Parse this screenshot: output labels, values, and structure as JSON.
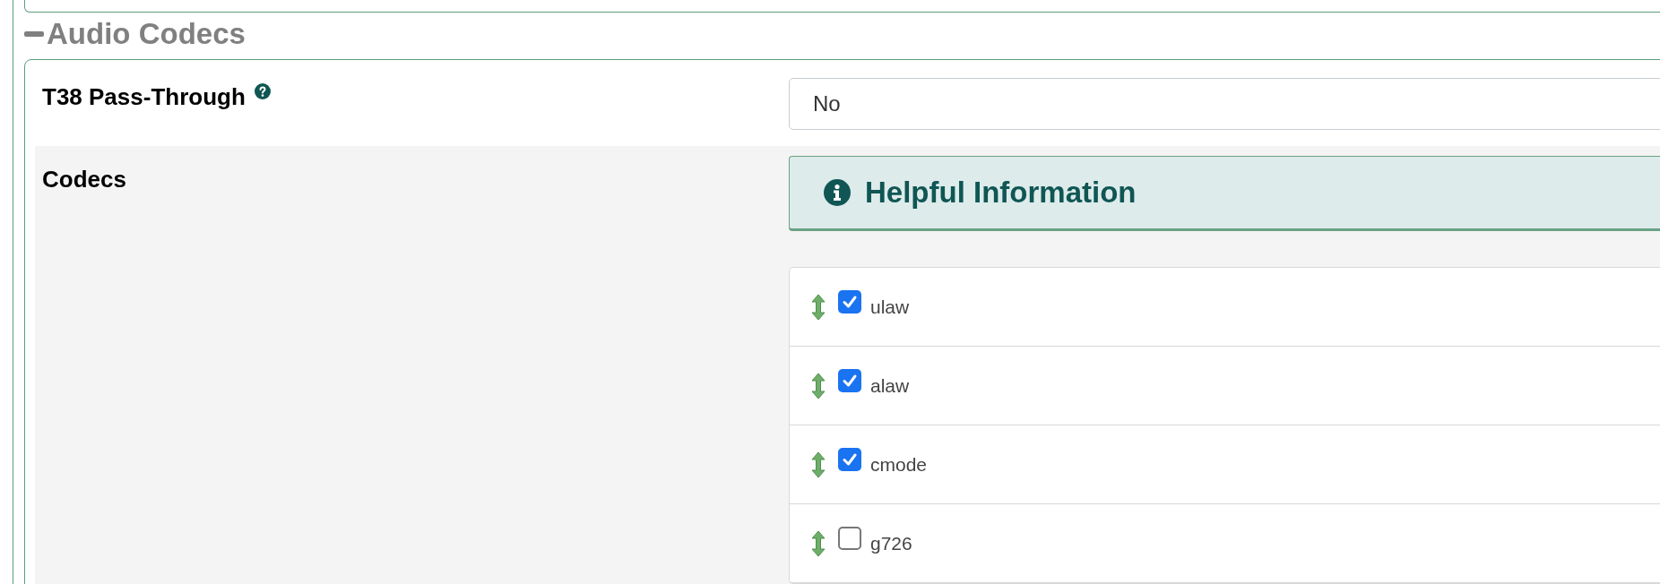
{
  "section": {
    "title": "Audio Codecs",
    "expanded": true
  },
  "t38": {
    "label": "T38 Pass-Through",
    "value": "No"
  },
  "codecs": {
    "label": "Codecs",
    "info_title": "Helpful Information",
    "items": [
      {
        "name": "ulaw",
        "checked": true
      },
      {
        "name": "alaw",
        "checked": true
      },
      {
        "name": "cmode",
        "checked": true
      },
      {
        "name": "g726",
        "checked": false
      }
    ]
  }
}
